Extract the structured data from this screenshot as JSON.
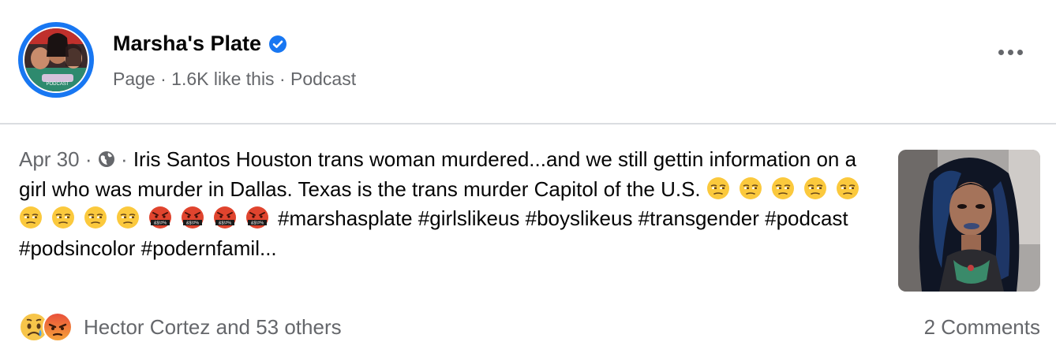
{
  "page": {
    "name": "Marsha's Plate",
    "meta": "Page · 1.6K like this · Podcast",
    "avatar_text": "PODCAST"
  },
  "post": {
    "date": "Apr 30",
    "separator": " · ",
    "text_main": "Iris Santos Houston trans woman murdered...and we still gettin information on a girl who was murder in Dallas. Texas is the trans murder Capitol of the U.S.",
    "emojis": [
      "unamused-face",
      "unamused-face",
      "unamused-face",
      "unamused-face",
      "unamused-face",
      "unamused-face",
      "unamused-face",
      "unamused-face",
      "unamused-face",
      "cursing-face",
      "cursing-face",
      "cursing-face",
      "cursing-face"
    ],
    "cursing_symbols": "&$!#%",
    "hashtags_line1": "#marshasplate",
    "hashtags_line2": "#girlslikeus #boyslikeus #transgender #podcast #podsincolor #podernfamil..."
  },
  "footer": {
    "reactions_text": "Hector Cortez and 53 others",
    "comments_text": "2 Comments",
    "reaction_icons": [
      "sad-reaction",
      "angry-reaction"
    ]
  },
  "colors": {
    "accent": "#1877f2",
    "secondary_text": "#65676b",
    "primary_text": "#050505",
    "divider": "#dadde1"
  }
}
